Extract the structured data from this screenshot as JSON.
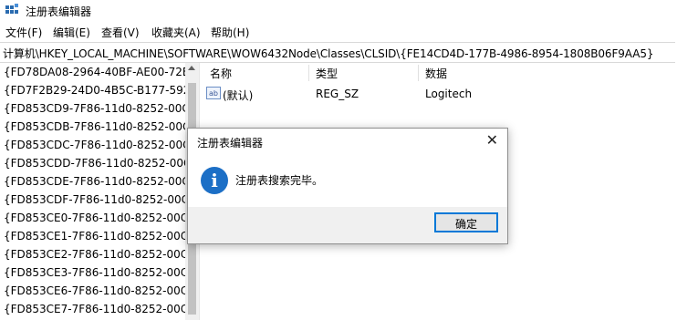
{
  "window": {
    "title": "注册表编辑器"
  },
  "menu": [
    {
      "label": "文件(F)"
    },
    {
      "label": "编辑(E)"
    },
    {
      "label": "查看(V)"
    },
    {
      "label": "收藏夹(A)"
    },
    {
      "label": "帮助(H)"
    }
  ],
  "address": {
    "path": "计算机\\HKEY_LOCAL_MACHINE\\SOFTWARE\\WOW6432Node\\Classes\\CLSID\\{FE14CD4D-177B-4986-8954-1808B06F9AA5}"
  },
  "tree": {
    "items": [
      "{FD78DA08-2964-40BF-AE00-72E/",
      "{FD7F2B29-24D0-4B5C-B177-592(",
      "{FD853CD9-7F86-11d0-8252-00C(",
      "{FD853CDB-7F86-11d0-8252-00C(",
      "{FD853CDC-7F86-11d0-8252-00C(",
      "{FD853CDD-7F86-11d0-8252-00C(",
      "{FD853CDE-7F86-11d0-8252-00C(",
      "{FD853CDF-7F86-11d0-8252-00C(",
      "{FD853CE0-7F86-11d0-8252-00C(",
      "{FD853CE1-7F86-11d0-8252-00C(",
      "{FD853CE2-7F86-11d0-8252-00C(",
      "{FD853CE3-7F86-11d0-8252-00C(",
      "{FD853CE6-7F86-11d0-8252-00C(",
      "{FD853CE7-7F86-11d0-8252-00C("
    ]
  },
  "values": {
    "headers": {
      "name": "名称",
      "type": "类型",
      "data": "数据"
    },
    "rows": [
      {
        "name": "(默认)",
        "type": "REG_SZ",
        "data": "Logitech",
        "icon": "ab"
      }
    ]
  },
  "dialog": {
    "title": "注册表编辑器",
    "message": "注册表搜索完毕。",
    "ok_label": "确定",
    "close_glyph": "✕",
    "icon_glyph": "i"
  },
  "colors": {
    "info_icon": "#1c6fc6",
    "button_border": "#0078d7"
  }
}
